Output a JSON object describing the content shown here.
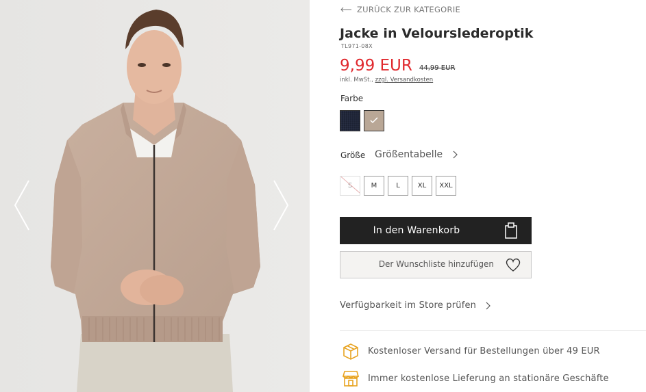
{
  "back_link": {
    "label": "ZURÜCK ZUR KATEGORIE",
    "icon": "arrow-left-icon"
  },
  "product": {
    "title": "Jacke in Velourslederoptik",
    "sku": "TL971-08X",
    "price": "9,99 EUR",
    "old_price": "44,99 EUR",
    "vat_text": "inkl. MwSt., ",
    "shipping_link": "zzgl. Versandkosten",
    "price_color": "#e0282d"
  },
  "color": {
    "label": "Farbe",
    "swatches": [
      {
        "name": "navy",
        "color": "#1c2233"
      },
      {
        "name": "beige",
        "color": "#b9a796",
        "selected": true
      }
    ]
  },
  "size": {
    "label": "Größe",
    "guide_label": "Größentabelle",
    "options": [
      {
        "label": "S",
        "available": false
      },
      {
        "label": "M",
        "available": true
      },
      {
        "label": "L",
        "available": true
      },
      {
        "label": "XL",
        "available": true
      },
      {
        "label": "XXL",
        "available": true
      }
    ]
  },
  "actions": {
    "cart_label": "In den Warenkorb",
    "wishlist_label": "Der Wunschliste hinzufügen",
    "store_check_label": "Verfügbarkeit im Store prüfen"
  },
  "benefits": [
    {
      "icon": "delivery-box-icon",
      "text": "Kostenloser Versand für Bestellungen über 49 EUR"
    },
    {
      "icon": "store-icon",
      "text": "Immer kostenlose Lieferung an stationäre Geschäfte"
    }
  ],
  "colors": {
    "accent": "#e0282d",
    "button_dark": "#222222",
    "icon_gold": "#e8a321"
  }
}
